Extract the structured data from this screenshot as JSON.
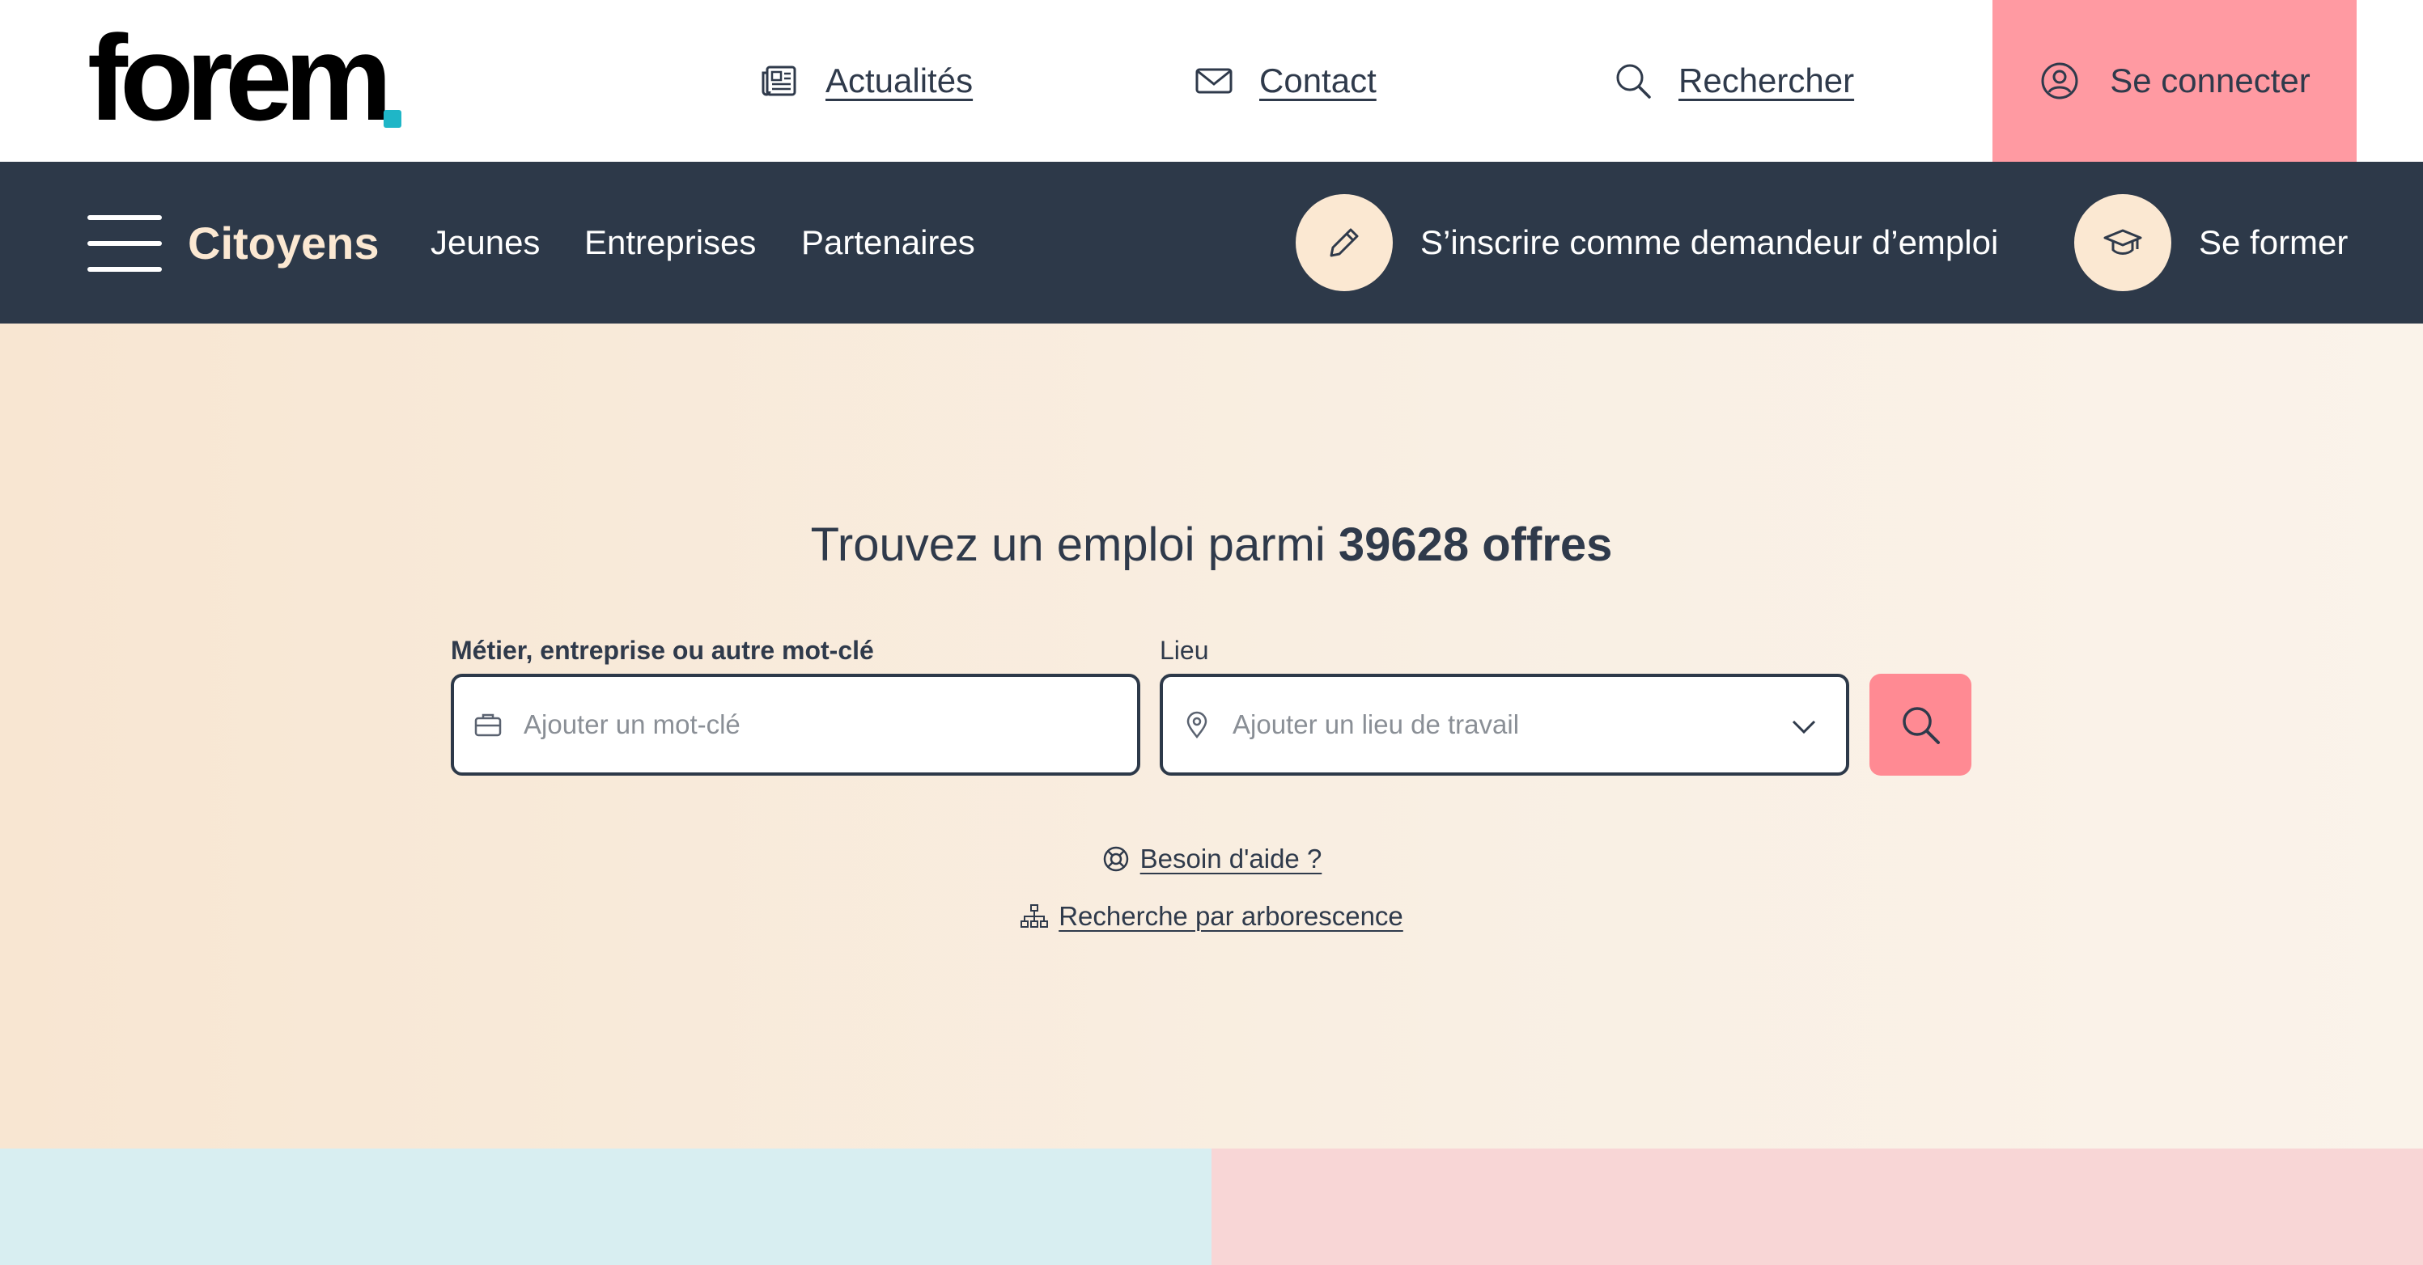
{
  "header": {
    "brand": "forem",
    "brand_accent": "#1fb6c7",
    "links": [
      {
        "label": "Actualités",
        "icon": "newspaper-icon"
      },
      {
        "label": "Contact",
        "icon": "mail-icon"
      },
      {
        "label": "Rechercher",
        "icon": "search-icon"
      }
    ],
    "login": {
      "label": "Se connecter",
      "icon": "user-icon",
      "color": "#ff9aa2"
    }
  },
  "nav": {
    "items": [
      {
        "label": "Citoyens",
        "active": true
      },
      {
        "label": "Jeunes"
      },
      {
        "label": "Entreprises"
      },
      {
        "label": "Partenaires"
      }
    ],
    "cta": [
      {
        "label": "S’inscrire comme demandeur d’emploi",
        "icon": "pencil-icon"
      },
      {
        "label": "Se former",
        "icon": "graduation-cap-icon"
      }
    ],
    "background": "#2d3949"
  },
  "hero": {
    "title_prefix": "Trouvez un emploi parmi",
    "title_count": "39628 offres",
    "keyword": {
      "label": "Métier, entreprise ou autre mot-clé",
      "placeholder": "Ajouter un mot-clé",
      "value": "",
      "icon": "briefcase-icon"
    },
    "location": {
      "label": "Lieu",
      "placeholder": "Ajouter un lieu de travail",
      "value": "",
      "icon": "map-pin-icon"
    },
    "search_icon": "search-icon",
    "search_color": "#ff8a93",
    "help_link": "Besoin d'aide ?",
    "tree_link": "Recherche par arborescence"
  },
  "tiles": {
    "left_color": "#d8eef1",
    "right_color": "#f8d6d6"
  }
}
